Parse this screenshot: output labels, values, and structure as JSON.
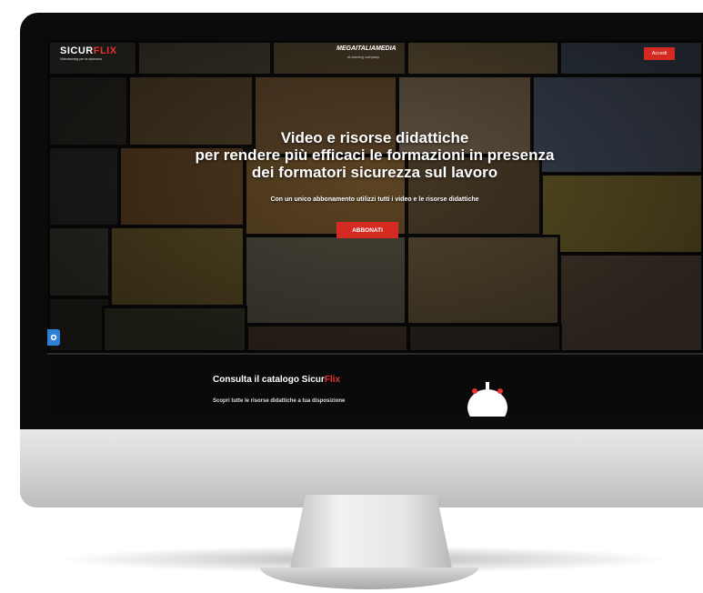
{
  "header": {
    "logo_main": "SICUR",
    "logo_accent": "FLIX",
    "logo_tagline": "Videotraining per la sicurezza",
    "partner_logo": "MEGAITALIAMEDIA",
    "partner_tagline": "eLearning company",
    "login_label": "Accedi"
  },
  "hero": {
    "line1": "Video e risorse didattiche",
    "line2": "per rendere più efficaci le formazioni in presenza",
    "line3": "dei formatori sicurezza sul lavoro",
    "subline": "Con un unico abbonamento utilizzi tutti i video e le risorse didattiche",
    "cta_label": "ABBONATI"
  },
  "catalog": {
    "title_main": "Consulta il catalogo Sicur",
    "title_accent": "Flix",
    "text": "Scopri tutte le risorse didattiche a tua disposizione"
  },
  "icons": {
    "side_widget": "accessibility-icon",
    "mascot": "robot-mascot-icon"
  },
  "colors": {
    "accent": "#d42a22",
    "side_widget": "#2f7fd8"
  }
}
